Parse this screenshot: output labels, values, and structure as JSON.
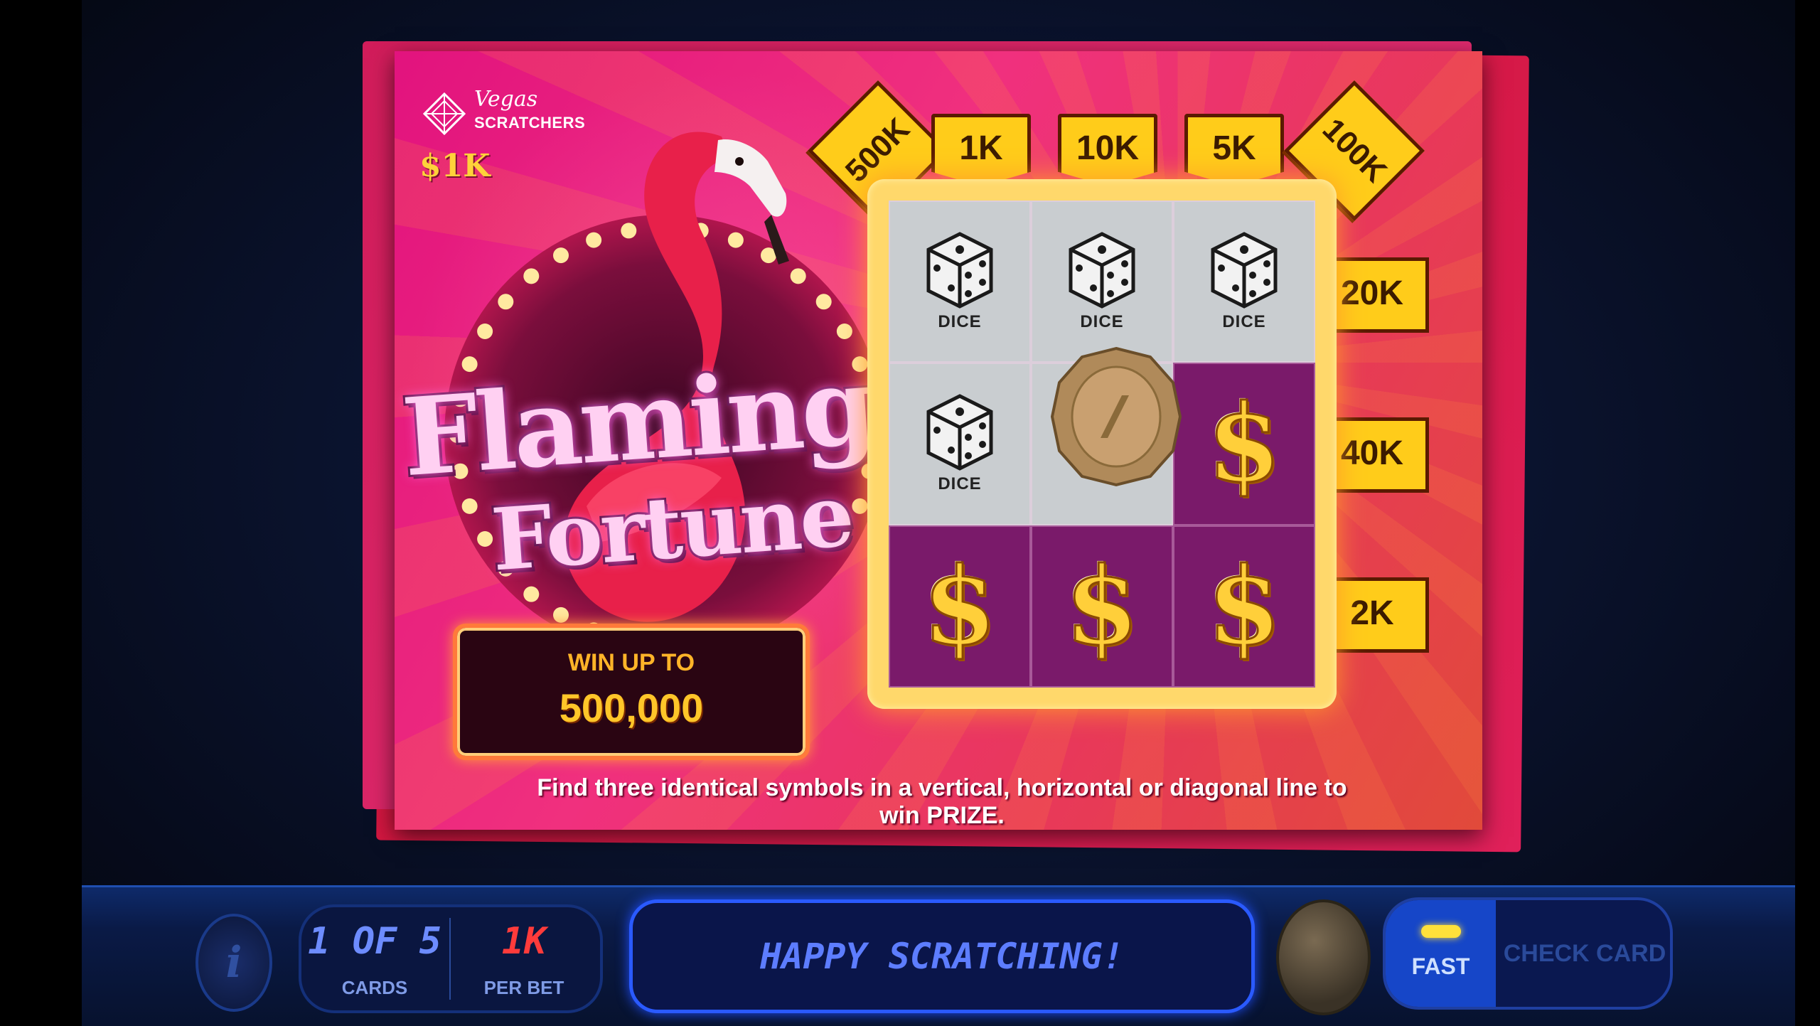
{
  "card": {
    "brand_line1": "Vegas",
    "brand_line2": "SCRATCHERS",
    "price": "$1K",
    "title_line1": "Flamingo",
    "title_line2": "Fortune",
    "win_label": "WIN UP TO",
    "win_amount": "500,000",
    "instructions": "Find three identical symbols in a vertical, horizontal or diagonal line to win PRIZE."
  },
  "prizes": {
    "diag_top_left": "500K",
    "col1": "1K",
    "col2": "10K",
    "col3": "5K",
    "diag_top_right": "100K",
    "row1": "20K",
    "row2": "40K",
    "row3": "2K"
  },
  "grid": {
    "cells": [
      {
        "symbol": "dice",
        "label": "DICE",
        "scratched": false
      },
      {
        "symbol": "dice",
        "label": "DICE",
        "scratched": false
      },
      {
        "symbol": "dice",
        "label": "DICE",
        "scratched": false
      },
      {
        "symbol": "dice",
        "label": "DICE",
        "scratched": false
      },
      {
        "symbol": "coin",
        "label": "",
        "scratched": false
      },
      {
        "symbol": "dollar",
        "label": "$",
        "scratched": true
      },
      {
        "symbol": "dollar",
        "label": "$",
        "scratched": true
      },
      {
        "symbol": "dollar",
        "label": "$",
        "scratched": true
      },
      {
        "symbol": "dollar",
        "label": "$",
        "scratched": true
      }
    ]
  },
  "hud": {
    "info_label": "i",
    "cards_value": "1 OF 5",
    "cards_label": "CARDS",
    "bet_value": "1K",
    "bet_label": "PER BET",
    "message": "HAPPY SCRATCHING!",
    "fast_label": "FAST",
    "check_label": "CHECK CARD"
  },
  "colors": {
    "bet_value": "#ff3b3b",
    "cards_value": "#6d8cff",
    "accent_gold": "#ffcc1a",
    "card_pink": "#e2137e"
  }
}
